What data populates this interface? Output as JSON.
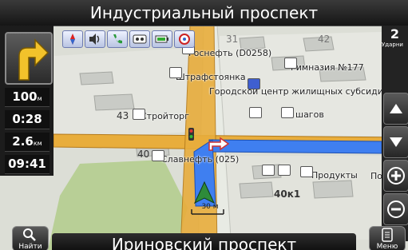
{
  "header": {
    "current_street": "Индустриальный проспект"
  },
  "footer": {
    "next_street": "Ириновский проспект"
  },
  "left_panel": {
    "distance_value": "100",
    "distance_unit": "м",
    "time_to_turn": "0:28",
    "total_distance_value": "2.6",
    "total_distance_unit": "км",
    "arrival_time": "09:41",
    "maneuver_icon": "turn-right-arrow-icon"
  },
  "status_icons": [
    "compass-icon",
    "volume-icon",
    "phone-icon",
    "tape-icon",
    "battery-icon",
    "gps-icon"
  ],
  "right_panel": {
    "zoom_level": "2",
    "zoom_caption": "Ударни"
  },
  "buttons": {
    "find_label": "Найти",
    "menu_label": "Меню"
  },
  "map": {
    "labels": {
      "rosneft": "Роснефть (D0258)",
      "gymnasium": "Гимназия №177",
      "parking": "Штрафстоянка",
      "housing_center": "Городской центр жилищных субсидий, фили",
      "stroytorg": "Стройторг",
      "shagov": "шагов",
      "slavneft": "Славнефть (025)",
      "products": "Продукты",
      "po": "По"
    },
    "house_numbers": {
      "n31": "31",
      "n42": "42",
      "n43": "43",
      "n40": "40",
      "n40k1": "40к1"
    },
    "scale": "30 м",
    "route_color": "#3f7ff0",
    "road_color": "#e8ad3c"
  }
}
